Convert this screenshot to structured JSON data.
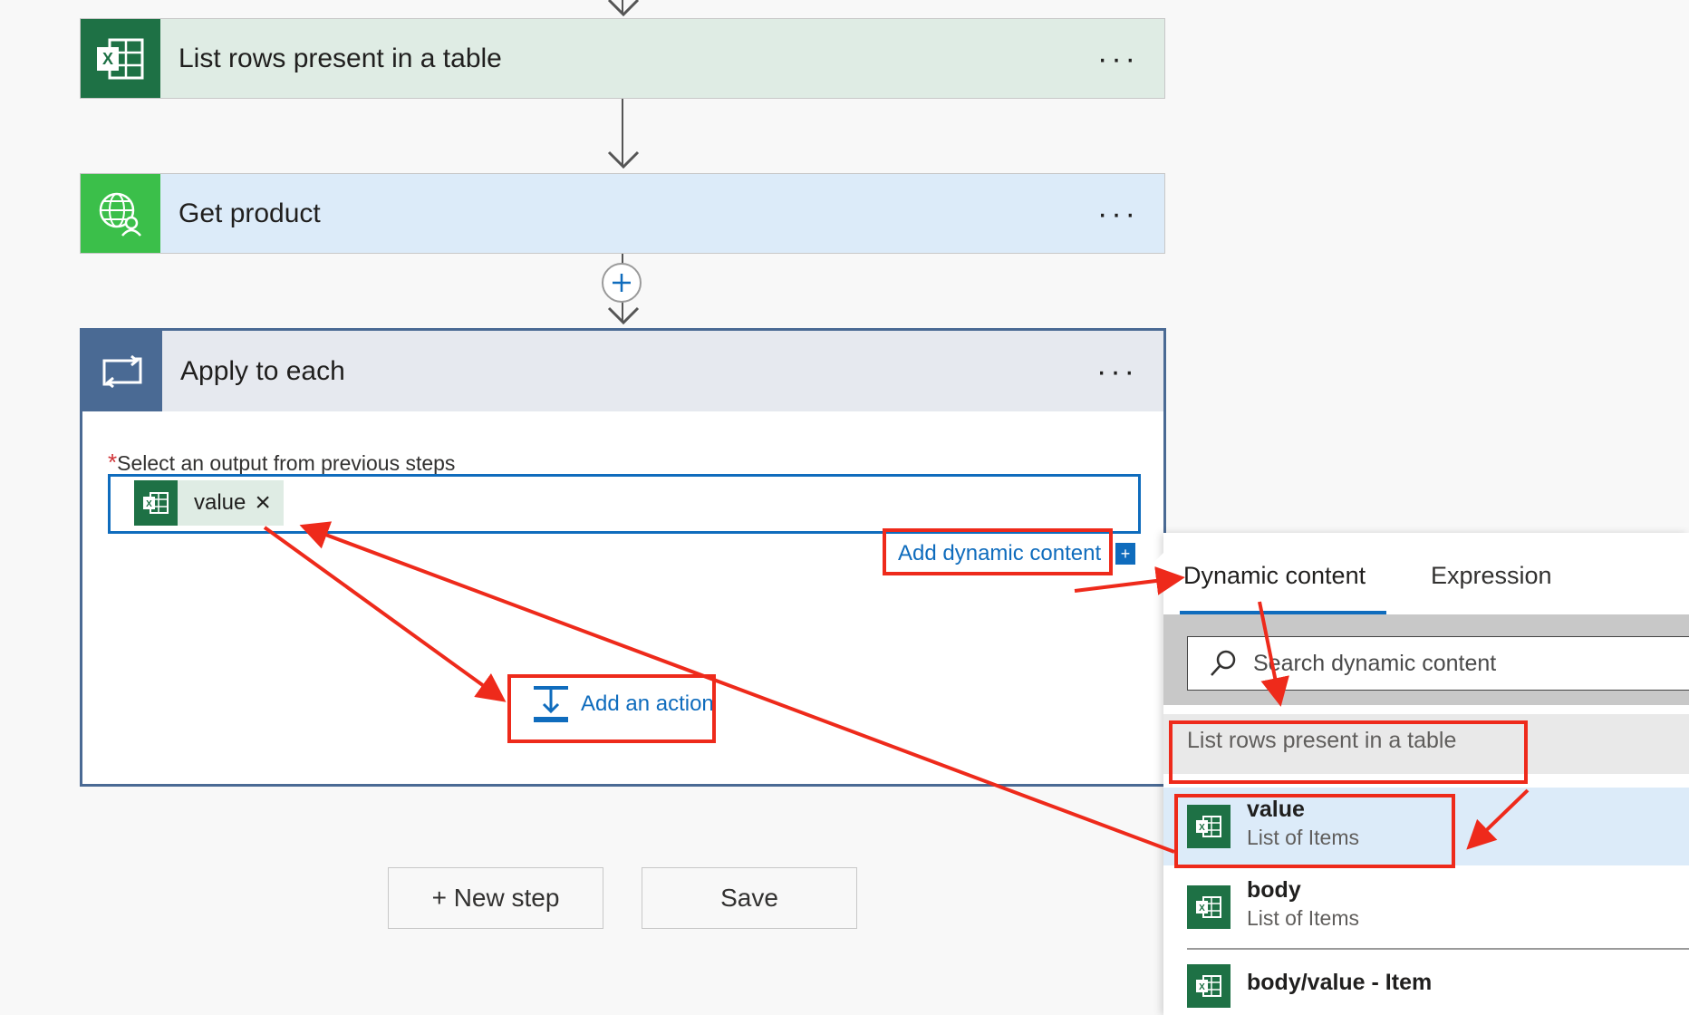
{
  "flow": {
    "steps": [
      {
        "title": "List rows present in a table",
        "more": "···"
      },
      {
        "title": "Get product",
        "more": "···"
      }
    ],
    "apply_to_each": {
      "title": "Apply to each",
      "more": "···",
      "required_mark": "*",
      "select_label": "Select an output from previous steps",
      "token_label": "value",
      "token_remove": "×",
      "add_dynamic_content": "Add dynamic content",
      "add_action": "Add an action"
    },
    "buttons": {
      "new_step": "+ New step",
      "save": "Save"
    }
  },
  "dynamic_panel": {
    "tabs": [
      "Dynamic content",
      "Expression"
    ],
    "search_placeholder": "Search dynamic content",
    "group_header": "List rows present in a table",
    "items": [
      {
        "title": "value",
        "subtitle": "List of Items"
      },
      {
        "title": "body",
        "subtitle": "List of Items"
      },
      {
        "title": "body/value - Item",
        "subtitle": ""
      }
    ]
  },
  "colors": {
    "excel_green": "#1e7145",
    "http_green": "#3bbf4a",
    "loop_blue": "#4a6a94",
    "accent_blue": "#0f6cbd",
    "annotation_red": "#ee2a1b"
  }
}
